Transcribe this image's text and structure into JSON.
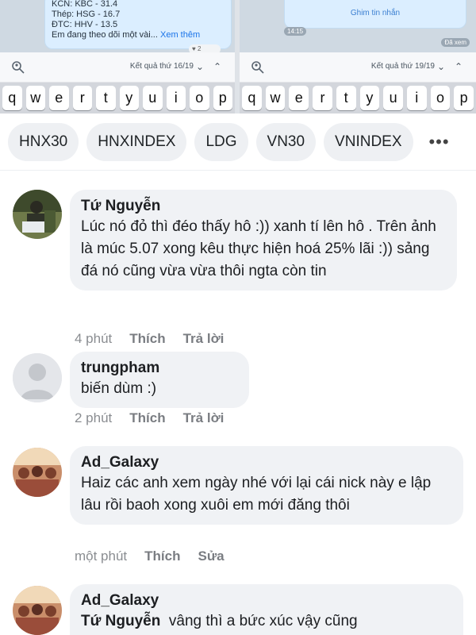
{
  "top_strip": {
    "left_pane": {
      "message_lines": [
        "KCN: KBC - 31.4",
        "Thép: HSG - 16.7",
        "ĐTC: HHV - 13.5",
        "Em đang theo dõi một vài..."
      ],
      "more_link": "Xem thêm",
      "reaction": "2",
      "result_label": "Kết quả thứ 16/19"
    },
    "right_pane": {
      "pin_label": "Ghim tin nhắn",
      "time": "14:15",
      "seen": "Đã xem",
      "result_label": "Kết quả thứ 19/19"
    },
    "keyboard_left": [
      "q",
      "w",
      "e",
      "r",
      "t",
      "y",
      "u",
      "i",
      "o",
      "p"
    ],
    "keyboard_right": [
      "q",
      "w",
      "e",
      "r",
      "t",
      "y",
      "u",
      "i",
      "o",
      "p"
    ]
  },
  "tickers": [
    "HNX30",
    "HNXINDEX",
    "LDG",
    "VN30",
    "VNINDEX"
  ],
  "tickers_more": "•••",
  "comments": [
    {
      "author": "Tứ Nguyễn",
      "text": "Lúc nó đỏ thì đéo thấy hô :)) xanh tí lên hô . Trên ảnh là múc 5.07 xong kêu thực hiện hoá 25% lãi :)) sảng đá nó cũng vừa vừa thôi ngta còn tin",
      "time": "4 phút",
      "like": "Thích",
      "reply": "Trả lời"
    },
    {
      "author": "trungpham",
      "text": "biến dùm :)",
      "time": "2 phút",
      "like": "Thích",
      "reply": "Trả lời"
    },
    {
      "author": "Ad_Galaxy",
      "text": "Haiz các anh xem ngày nhé với lại cái nick này e lập lâu rồi baoh xong xuôi em mới đăng thôi",
      "time": "một phút",
      "like": "Thích",
      "reply": "Sửa"
    },
    {
      "author": "Ad_Galaxy",
      "mention": "Tứ Nguyễn",
      "text": "vâng thì a bức xúc vậy cũng"
    }
  ],
  "colors": {
    "bubble_bg": "#f0f2f5",
    "chip_bg": "#eef0f3",
    "meta_text": "#8a8d91",
    "link_blue": "#1a73e8"
  }
}
